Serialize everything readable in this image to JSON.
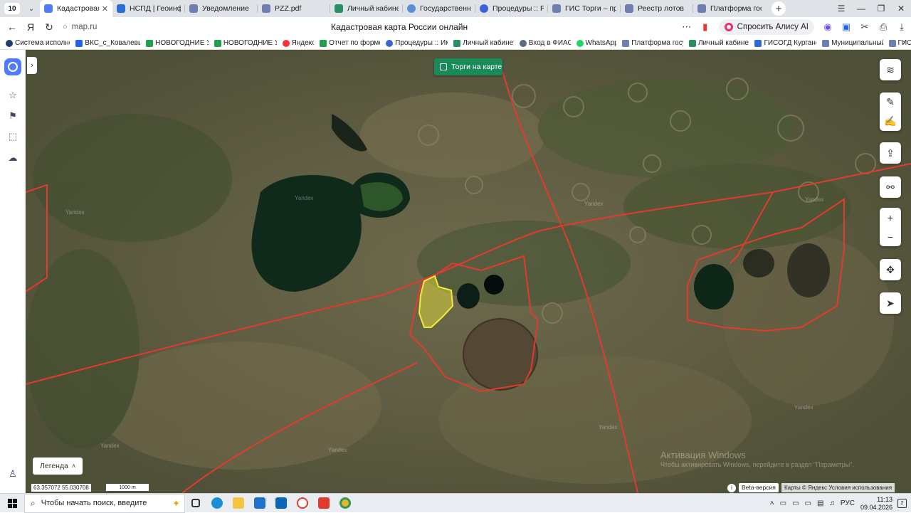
{
  "browser": {
    "tab_count": "10",
    "tabs": [
      {
        "label": "Кадастровая к",
        "icon": "yandex-maps-icon",
        "color": "#4f7cff",
        "active": true
      },
      {
        "label": "НСПД | Геоинфор",
        "icon": "nspd-icon",
        "color": "#2b6cd6"
      },
      {
        "label": "Уведомление",
        "icon": "emblem-icon",
        "color": "#6e7fb0"
      },
      {
        "label": "PZZ.pdf",
        "icon": "emblem-icon",
        "color": "#6e7fb0"
      },
      {
        "label": "Личный кабинет",
        "icon": "square-icon",
        "color": "#2a8f63"
      },
      {
        "label": "Государственный",
        "icon": "globe-icon",
        "color": "#5d8fd8"
      },
      {
        "label": "Процедуры :: Реа",
        "icon": "procedures-icon",
        "color": "#3c64d8"
      },
      {
        "label": "ГИС Торги – прод",
        "icon": "emblem-icon",
        "color": "#6e7fb0"
      },
      {
        "label": "Реестр лотов",
        "icon": "emblem-icon",
        "color": "#6e7fb0"
      },
      {
        "label": "Платформа госуд",
        "icon": "emblem-icon",
        "color": "#6e7fb0"
      }
    ],
    "url": "map.ru",
    "page_title": "Кадастровая карта России онлайн",
    "alice_label": "Спросить Алису AI"
  },
  "bookmarks": [
    {
      "label": "Система исполне",
      "color": "#1c3d6e"
    },
    {
      "label": "ВКС_с_Ковалевы",
      "color": "#2563eb"
    },
    {
      "label": "НОВОГОДНИЕ У",
      "color": "#22a04a"
    },
    {
      "label": "НОВОГОДНИЕ У",
      "color": "#22a04a"
    },
    {
      "label": "Яндекс",
      "color": "#f33"
    },
    {
      "label": "Отчет по форме",
      "color": "#22a04a"
    },
    {
      "label": "Процедуры :: Им",
      "color": "#3c64d8"
    },
    {
      "label": "Личный кабинет",
      "color": "#2a8f63"
    },
    {
      "label": "Вход в ФИАС",
      "color": "#5d6b80"
    },
    {
      "label": "WhatsApp",
      "color": "#25d366"
    },
    {
      "label": "Платформа госу",
      "color": "#6e7fb0"
    },
    {
      "label": "Личный кабинет",
      "color": "#2a8f63"
    },
    {
      "label": "ГИСОГД Курганс",
      "color": "#2b6cd6"
    },
    {
      "label": "Муниципальный",
      "color": "#6e7fb0"
    },
    {
      "label": "ГИС",
      "color": "#6e7fb0"
    }
  ],
  "map": {
    "auction_toggle_label": "Торги на карте",
    "legend_label": "Легенда",
    "coordinates": "63.357072 55.030708",
    "scale_label": "1000 m",
    "beta_label": "Beta-версия",
    "copyright": "Карты © Яндекс   Условия использования",
    "watermark_title": "Активация Windows",
    "watermark_text": "Чтобы активировать Windows, перейдите в раздел \"Параметры\".",
    "map_label": "Yandex",
    "colors": {
      "boundary": "#e23b2e",
      "selected_parcel": "#f2ea3a"
    }
  },
  "taskbar": {
    "search_placeholder": "Чтобы начать поиск, введите",
    "language": "РУС",
    "time": "11:13",
    "date": "09.04.2026",
    "notifications": "2"
  }
}
